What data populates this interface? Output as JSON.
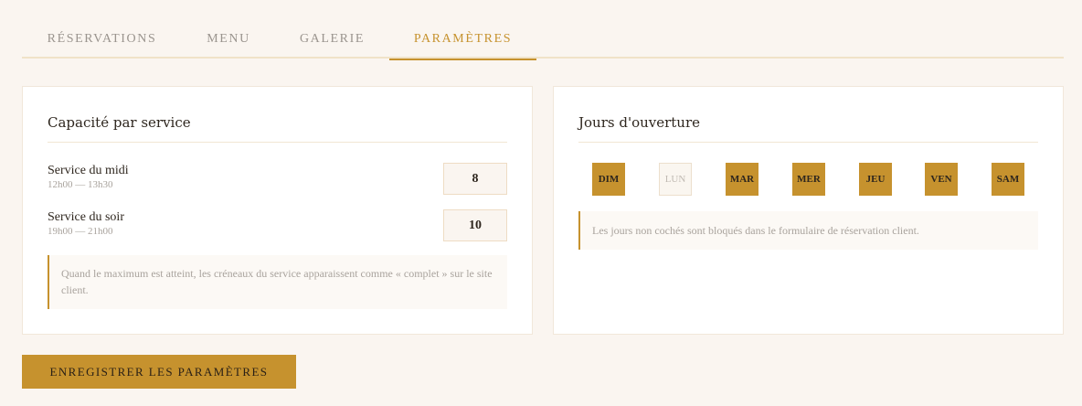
{
  "tabs": [
    {
      "label": "RÉSERVATIONS"
    },
    {
      "label": "MENU"
    },
    {
      "label": "GALERIE"
    },
    {
      "label": "PARAMÈTRES"
    }
  ],
  "capacity": {
    "title": "Capacité par service",
    "lunch": {
      "label": "Service du midi",
      "hours": "12h00 — 13h30",
      "value": "8"
    },
    "dinner": {
      "label": "Service du soir",
      "hours": "19h00 — 21h00",
      "value": "10"
    },
    "note": "Quand le maximum est atteint, les créneaux du service apparaissent comme « complet » sur le site client."
  },
  "opening": {
    "title": "Jours d'ouverture",
    "days": [
      {
        "label": "DIM"
      },
      {
        "label": "LUN"
      },
      {
        "label": "MAR"
      },
      {
        "label": "MER"
      },
      {
        "label": "JEU"
      },
      {
        "label": "VEN"
      },
      {
        "label": "SAM"
      }
    ],
    "note": "Les jours non cochés sont bloqués dans le formulaire de réservation client."
  },
  "save_label": "ENREGISTRER LES PARAMÈTRES",
  "colors": {
    "accent": "#c6922e",
    "background": "#faf5f0"
  }
}
